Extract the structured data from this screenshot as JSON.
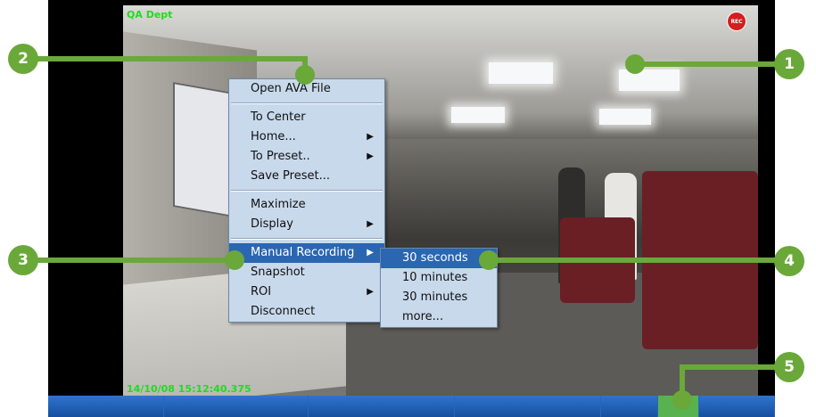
{
  "osd": {
    "camera_title": "QA Dept",
    "timestamp": "14/10/08 15:12:40.375",
    "rec_badge": "REC"
  },
  "context_menu": {
    "items": [
      {
        "label": "Open AVA File",
        "submenu": false
      },
      {
        "label": "To Center",
        "submenu": false
      },
      {
        "label": "Home...",
        "submenu": true
      },
      {
        "label": "To Preset..",
        "submenu": true
      },
      {
        "label": "Save Preset...",
        "submenu": false
      },
      {
        "label": "Maximize",
        "submenu": false
      },
      {
        "label": "Display",
        "submenu": true
      },
      {
        "label": "Manual Recording",
        "submenu": true,
        "selected": true
      },
      {
        "label": "Snapshot",
        "submenu": false
      },
      {
        "label": "ROI",
        "submenu": true
      },
      {
        "label": "Disconnect",
        "submenu": false
      }
    ]
  },
  "recording_submenu": {
    "items": [
      {
        "label": "30 seconds",
        "selected": true
      },
      {
        "label": "10 minutes"
      },
      {
        "label": "30 minutes"
      },
      {
        "label": "more..."
      }
    ]
  },
  "callouts": [
    "1",
    "2",
    "3",
    "4",
    "5"
  ],
  "colors": {
    "callout_green": "#6aa83a",
    "osd_text": "#1fdc1f",
    "menu_bg": "#c8d9ec",
    "menu_selected": "#2b66b0",
    "statusbar_blue": "#2f74cf"
  },
  "icons": {
    "submenu_arrow": "submenu-arrow-icon",
    "rec": "rec-icon"
  }
}
